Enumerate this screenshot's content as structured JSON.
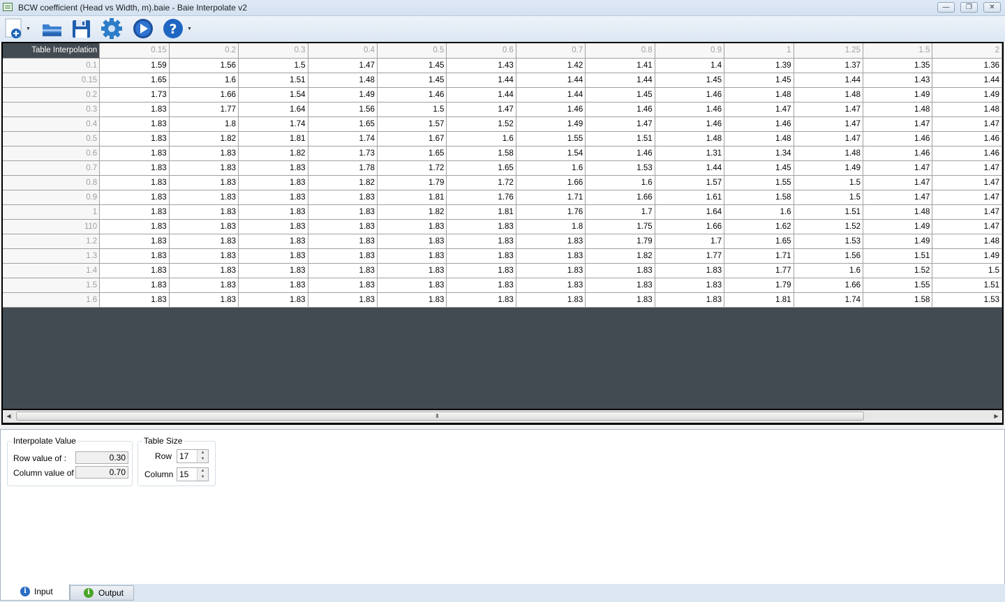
{
  "window": {
    "title": "BCW coefficient (Head vs Width, m).baie - Baie Interpolate v2",
    "minimize": "—",
    "restore": "❐",
    "close": "✕"
  },
  "toolbar": {
    "buttons": [
      {
        "name": "new-button",
        "icon": "add-document-icon",
        "has_dropdown": true
      },
      {
        "name": "open-button",
        "icon": "open-folder-icon"
      },
      {
        "name": "save-button",
        "icon": "floppy-disk-icon"
      },
      {
        "name": "settings-button",
        "icon": "gear-icon"
      },
      {
        "name": "run-button",
        "icon": "play-icon"
      },
      {
        "name": "help-button",
        "icon": "question-icon",
        "has_dropdown": true
      }
    ]
  },
  "table": {
    "corner_label": "Table Interpolation",
    "column_headers": [
      "0.15",
      "0.2",
      "0.3",
      "0.4",
      "0.5",
      "0.6",
      "0.7",
      "0.8",
      "0.9",
      "1",
      "1.25",
      "1.5",
      "2"
    ],
    "rows": [
      {
        "header": "0.1",
        "values": [
          "1.59",
          "1.56",
          "1.5",
          "1.47",
          "1.45",
          "1.43",
          "1.42",
          "1.41",
          "1.4",
          "1.39",
          "1.37",
          "1.35",
          "1.36"
        ]
      },
      {
        "header": "0.15",
        "values": [
          "1.65",
          "1.6",
          "1.51",
          "1.48",
          "1.45",
          "1.44",
          "1.44",
          "1.44",
          "1.45",
          "1.45",
          "1.44",
          "1.43",
          "1.44"
        ]
      },
      {
        "header": "0.2",
        "values": [
          "1.73",
          "1.66",
          "1.54",
          "1.49",
          "1.46",
          "1.44",
          "1.44",
          "1.45",
          "1.46",
          "1.48",
          "1.48",
          "1.49",
          "1.49"
        ]
      },
      {
        "header": "0.3",
        "values": [
          "1.83",
          "1.77",
          "1.64",
          "1.56",
          "1.5",
          "1.47",
          "1.46",
          "1.46",
          "1.46",
          "1.47",
          "1.47",
          "1.48",
          "1.48"
        ]
      },
      {
        "header": "0.4",
        "values": [
          "1.83",
          "1.8",
          "1.74",
          "1.65",
          "1.57",
          "1.52",
          "1.49",
          "1.47",
          "1.46",
          "1.46",
          "1.47",
          "1.47",
          "1.47"
        ]
      },
      {
        "header": "0.5",
        "values": [
          "1.83",
          "1.82",
          "1.81",
          "1.74",
          "1.67",
          "1.6",
          "1.55",
          "1.51",
          "1.48",
          "1.48",
          "1.47",
          "1.46",
          "1.46"
        ]
      },
      {
        "header": "0.6",
        "values": [
          "1.83",
          "1.83",
          "1.82",
          "1.73",
          "1.65",
          "1.58",
          "1.54",
          "1.46",
          "1.31",
          "1.34",
          "1.48",
          "1.46",
          "1.46"
        ]
      },
      {
        "header": "0.7",
        "values": [
          "1.83",
          "1.83",
          "1.83",
          "1.78",
          "1.72",
          "1.65",
          "1.6",
          "1.53",
          "1.44",
          "1.45",
          "1.49",
          "1.47",
          "1.47"
        ]
      },
      {
        "header": "0.8",
        "values": [
          "1.83",
          "1.83",
          "1.83",
          "1.82",
          "1.79",
          "1.72",
          "1.66",
          "1.6",
          "1.57",
          "1.55",
          "1.5",
          "1.47",
          "1.47"
        ]
      },
      {
        "header": "0.9",
        "values": [
          "1.83",
          "1.83",
          "1.83",
          "1.83",
          "1.81",
          "1.76",
          "1.71",
          "1.66",
          "1.61",
          "1.58",
          "1.5",
          "1.47",
          "1.47"
        ]
      },
      {
        "header": "1",
        "values": [
          "1.83",
          "1.83",
          "1.83",
          "1.83",
          "1.82",
          "1.81",
          "1.76",
          "1.7",
          "1.64",
          "1.6",
          "1.51",
          "1.48",
          "1.47"
        ]
      },
      {
        "header": "110",
        "values": [
          "1.83",
          "1.83",
          "1.83",
          "1.83",
          "1.83",
          "1.83",
          "1.8",
          "1.75",
          "1.66",
          "1.62",
          "1.52",
          "1.49",
          "1.47"
        ]
      },
      {
        "header": "1.2",
        "values": [
          "1.83",
          "1.83",
          "1.83",
          "1.83",
          "1.83",
          "1.83",
          "1.83",
          "1.79",
          "1.7",
          "1.65",
          "1.53",
          "1.49",
          "1.48"
        ]
      },
      {
        "header": "1.3",
        "values": [
          "1.83",
          "1.83",
          "1.83",
          "1.83",
          "1.83",
          "1.83",
          "1.83",
          "1.82",
          "1.77",
          "1.71",
          "1.56",
          "1.51",
          "1.49"
        ]
      },
      {
        "header": "1.4",
        "values": [
          "1.83",
          "1.83",
          "1.83",
          "1.83",
          "1.83",
          "1.83",
          "1.83",
          "1.83",
          "1.83",
          "1.77",
          "1.6",
          "1.52",
          "1.5"
        ]
      },
      {
        "header": "1.5",
        "values": [
          "1.83",
          "1.83",
          "1.83",
          "1.83",
          "1.83",
          "1.83",
          "1.83",
          "1.83",
          "1.83",
          "1.79",
          "1.66",
          "1.55",
          "1.51"
        ]
      },
      {
        "header": "1.6",
        "values": [
          "1.83",
          "1.83",
          "1.83",
          "1.83",
          "1.83",
          "1.83",
          "1.83",
          "1.83",
          "1.83",
          "1.81",
          "1.74",
          "1.58",
          "1.53"
        ]
      }
    ]
  },
  "scrollbar": {
    "grip": "III"
  },
  "interpolate": {
    "legend": "Interpolate Value",
    "row_label": "Row value of :",
    "row_value": "0.30",
    "column_label": "Column value of :",
    "column_value": "0.70"
  },
  "table_size": {
    "legend": "Table Size",
    "row_label": "Row",
    "row_value": "17",
    "column_label": "Column",
    "column_value": "15"
  },
  "tabs": [
    {
      "label": "Input",
      "active": true,
      "icon": "info-icon",
      "icon_color": "#2a6cc4"
    },
    {
      "label": "Output",
      "active": false,
      "icon": "info-icon",
      "icon_color": "#4aa528"
    }
  ]
}
